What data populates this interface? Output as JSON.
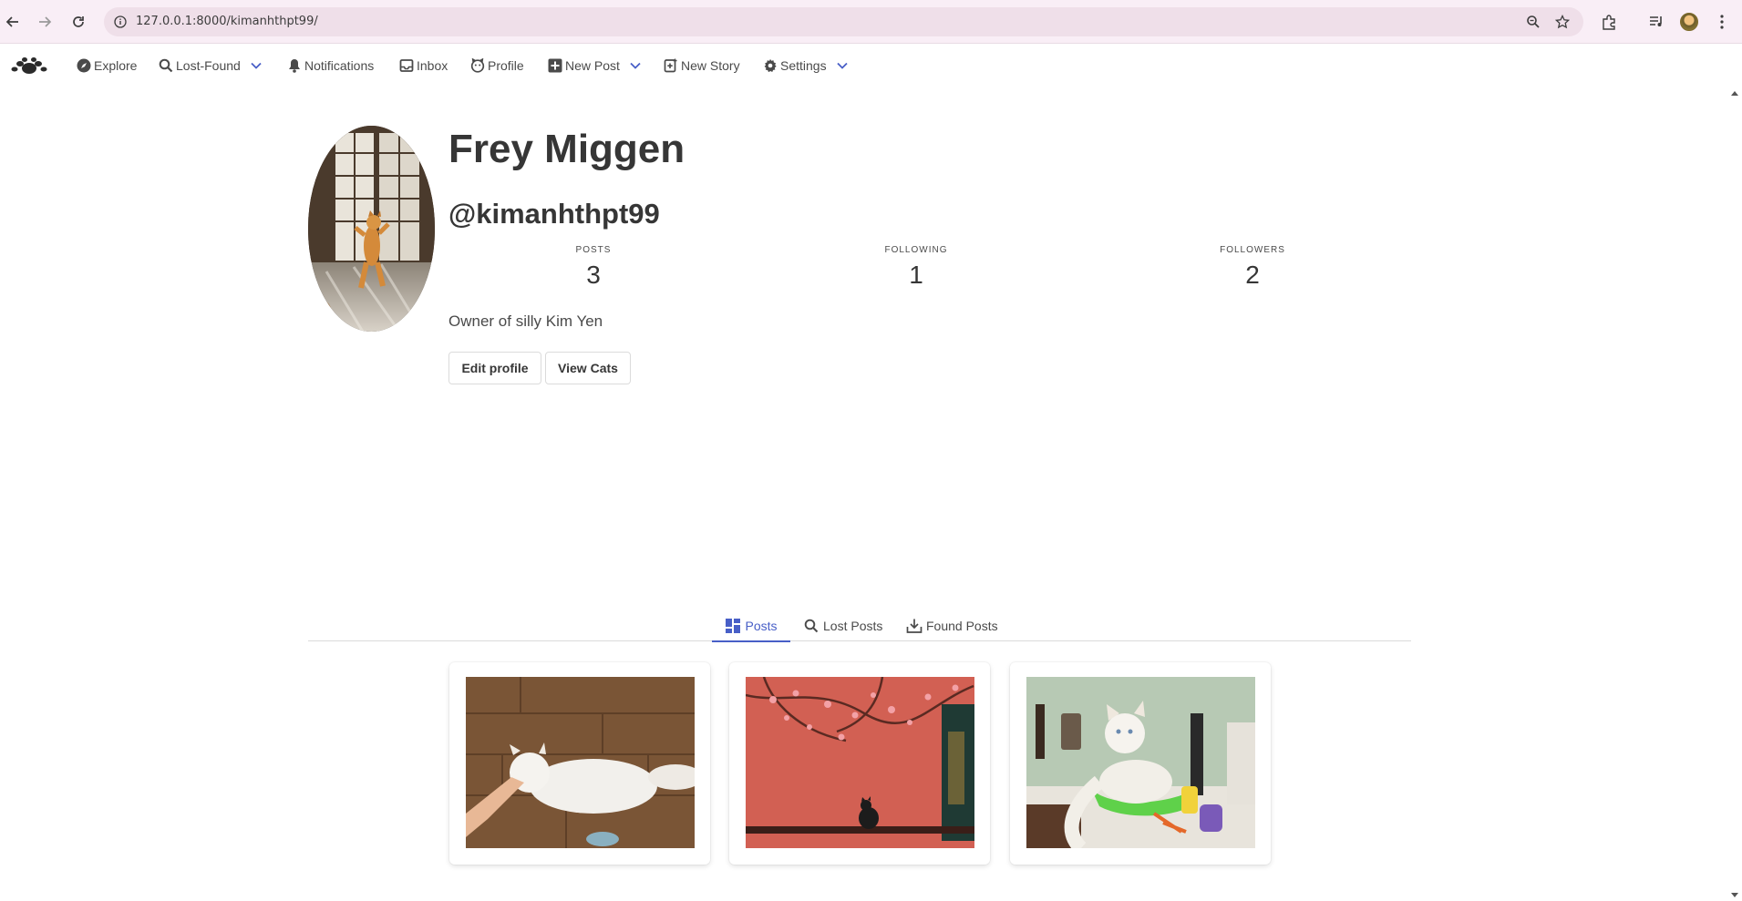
{
  "browser": {
    "url": "127.0.0.1:8000/kimanhthpt99/"
  },
  "navbar": {
    "items": [
      {
        "label": "Explore"
      },
      {
        "label": "Lost-Found"
      },
      {
        "label": "Notifications"
      },
      {
        "label": "Inbox"
      },
      {
        "label": "Profile"
      },
      {
        "label": "New Post"
      },
      {
        "label": "New Story"
      },
      {
        "label": "Settings"
      }
    ]
  },
  "profile": {
    "display_name": "Frey Miggen",
    "username": "@kimanhthpt99",
    "stats": [
      {
        "label": "POSTS",
        "value": "3"
      },
      {
        "label": "FOLLOWING",
        "value": "1"
      },
      {
        "label": "FOLLOWERS",
        "value": "2"
      }
    ],
    "bio": "Owner of silly Kim Yen",
    "edit_label": "Edit profile",
    "view_cats_label": "View Cats"
  },
  "tabs": [
    {
      "label": "Posts",
      "active": true
    },
    {
      "label": "Lost Posts",
      "active": false
    },
    {
      "label": "Found Posts",
      "active": false
    }
  ],
  "colors": {
    "accent": "#485fc7",
    "text": "#363636",
    "chrome_bg": "#f9eef6"
  }
}
